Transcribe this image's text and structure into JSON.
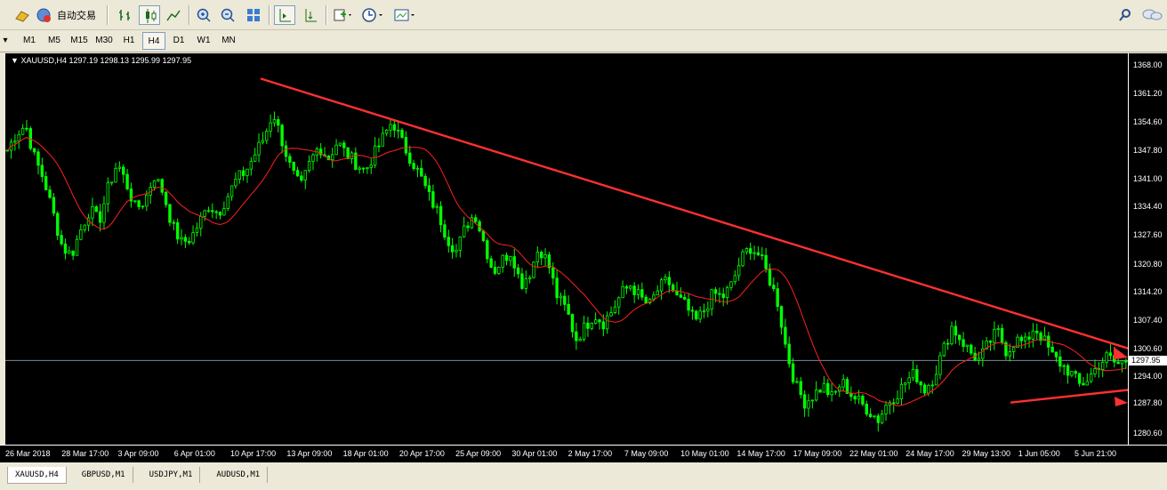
{
  "toolbar": {
    "auto_trade_label": "自动交易"
  },
  "timeframes": [
    "M1",
    "M5",
    "M15",
    "M30",
    "H1",
    "H4",
    "D1",
    "W1",
    "MN"
  ],
  "active_timeframe": "H4",
  "chart": {
    "header": "XAUUSD,H4  1297.19 1298.13 1295.99 1297.95",
    "symbol": "XAUUSD",
    "timeframe": "H4",
    "current_price_label": "1297.95",
    "colors": {
      "background": "#000000",
      "bull": "#00ff00",
      "bear": "#00ff00",
      "ma": "#ff2020",
      "trendline": "#ff3030"
    }
  },
  "chart_data": {
    "type": "candlestick",
    "yticks": [
      "1368.00",
      "1361.20",
      "1354.60",
      "1347.80",
      "1341.00",
      "1334.40",
      "1327.60",
      "1320.80",
      "1314.20",
      "1307.40",
      "1300.60",
      "1294.00",
      "1287.80",
      "1280.60"
    ],
    "xticks": [
      "26 Mar 2018",
      "28 Mar 17:00",
      "3 Apr 09:00",
      "6 Apr 01:00",
      "10 Apr 17:00",
      "13 Apr 09:00",
      "18 Apr 01:00",
      "20 Apr 17:00",
      "25 Apr 09:00",
      "30 Apr 01:00",
      "2 May 17:00",
      "7 May 09:00",
      "10 May 01:00",
      "14 May 17:00",
      "17 May 09:00",
      "22 May 01:00",
      "24 May 17:00",
      "29 May 13:00",
      "1 Jun 05:00",
      "5 Jun 21:00"
    ],
    "ylim": [
      1278.0,
      1371.0
    ],
    "close_path": [
      1348,
      1352,
      1354,
      1346,
      1341,
      1333,
      1325,
      1323,
      1329,
      1334,
      1331,
      1339,
      1345,
      1340,
      1334,
      1336,
      1342,
      1338,
      1330,
      1326,
      1327,
      1331,
      1335,
      1333,
      1337,
      1341,
      1343,
      1347,
      1351,
      1357,
      1350,
      1343,
      1339,
      1345,
      1349,
      1346,
      1350,
      1347,
      1345,
      1343,
      1347,
      1351,
      1355,
      1350,
      1346,
      1342,
      1337,
      1333,
      1327,
      1324,
      1330,
      1333,
      1326,
      1319,
      1322,
      1324,
      1316,
      1319,
      1325,
      1321,
      1313,
      1310,
      1303,
      1306,
      1309,
      1307,
      1310,
      1314,
      1316,
      1313,
      1311,
      1315,
      1317,
      1313,
      1311,
      1307,
      1310,
      1314,
      1313,
      1316,
      1322,
      1325,
      1323,
      1318,
      1312,
      1300,
      1292,
      1288,
      1290,
      1292,
      1289,
      1293,
      1290,
      1288,
      1286,
      1284,
      1288,
      1290,
      1293,
      1295,
      1291,
      1294,
      1300,
      1306,
      1303,
      1300,
      1298,
      1302,
      1305,
      1300,
      1303,
      1302,
      1306,
      1303,
      1299,
      1297,
      1295,
      1292,
      1294,
      1297,
      1299,
      1297,
      1298
    ],
    "trendlines": [
      {
        "name": "descending",
        "start": [
          287,
          1365
        ],
        "end": [
          1306,
          1298
        ]
      },
      {
        "name": "ascending",
        "start": [
          1130,
          1288
        ],
        "end": [
          1306,
          1292
        ]
      }
    ]
  },
  "symbol_tabs": [
    "XAUUSD,H4",
    "GBPUSD,M1",
    "USDJPY,M1",
    "AUDUSD,M1"
  ],
  "active_tab": "XAUUSD,H4"
}
